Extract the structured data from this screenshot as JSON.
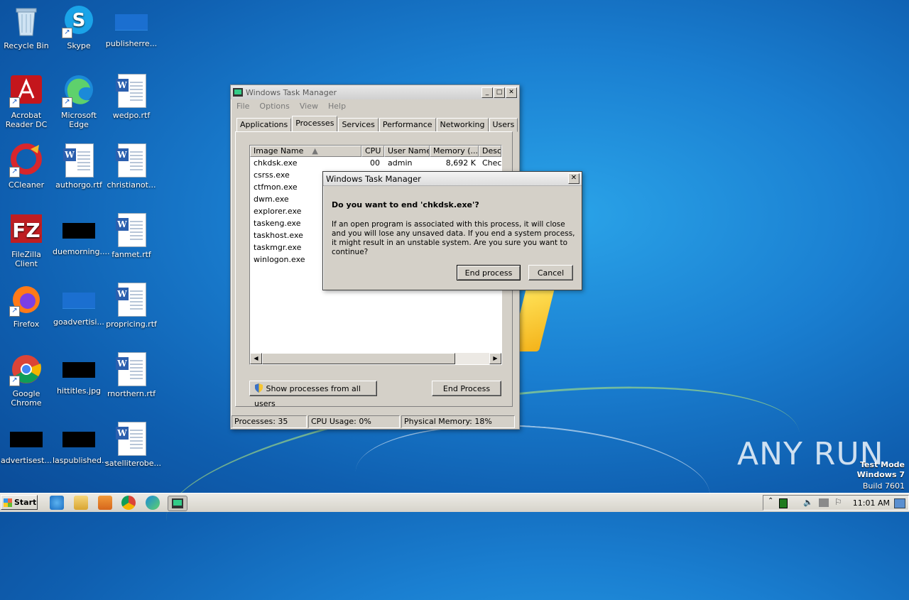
{
  "desktop": {
    "icons": [
      {
        "label": "Recycle Bin"
      },
      {
        "label": "Skype"
      },
      {
        "label": "publisherre..."
      },
      {
        "label": "Acrobat Reader DC"
      },
      {
        "label": "Microsoft Edge"
      },
      {
        "label": "wedpo.rtf"
      },
      {
        "label": "CCleaner"
      },
      {
        "label": "authorgo.rtf"
      },
      {
        "label": "christianot..."
      },
      {
        "label": "FileZilla Client"
      },
      {
        "label": "duemorning...."
      },
      {
        "label": "fanmet.rtf"
      },
      {
        "label": "Firefox"
      },
      {
        "label": "goadvertisi..."
      },
      {
        "label": "propricing.rtf"
      },
      {
        "label": "Google Chrome"
      },
      {
        "label": "hittitles.jpg"
      },
      {
        "label": "rnorthern.rtf"
      },
      {
        "label": "advertisest..."
      },
      {
        "label": "laspublished..."
      },
      {
        "label": "satelliterobe..."
      }
    ],
    "watermark": {
      "brand": "ANY RUN",
      "line1": "Test Mode",
      "line2": "Windows 7",
      "line3": "Build 7601"
    }
  },
  "taskmgr": {
    "title": "Windows Task Manager",
    "menu": [
      "File",
      "Options",
      "View",
      "Help"
    ],
    "tabs": [
      "Applications",
      "Processes",
      "Services",
      "Performance",
      "Networking",
      "Users"
    ],
    "active_tab": "Processes",
    "columns": [
      "Image Name",
      "CPU",
      "User Name",
      "Memory (...",
      "Desc"
    ],
    "rows": [
      [
        "chkdsk.exe",
        "00",
        "admin",
        "8,692 K",
        "Chec"
      ],
      [
        "csrss.exe",
        "",
        "",
        "",
        ""
      ],
      [
        "ctfmon.exe",
        "",
        "",
        "",
        ""
      ],
      [
        "dwm.exe",
        "",
        "",
        "",
        ""
      ],
      [
        "explorer.exe",
        "",
        "",
        "",
        ""
      ],
      [
        "taskeng.exe",
        "",
        "",
        "",
        ""
      ],
      [
        "taskhost.exe",
        "",
        "",
        "",
        ""
      ],
      [
        "taskmgr.exe",
        "",
        "",
        "",
        ""
      ],
      [
        "winlogon.exe",
        "",
        "",
        "",
        ""
      ]
    ],
    "show_all_label": "Show processes from all users",
    "end_process_label": "End Process",
    "status": {
      "processes": "Processes: 35",
      "cpu": "CPU Usage: 0%",
      "memory": "Physical Memory: 18%"
    }
  },
  "dialog": {
    "title": "Windows Task Manager",
    "question": "Do you want to end 'chkdsk.exe'?",
    "message": "If an open program is associated with this process, it will close and you will lose any unsaved data. If you end a system process, it might result in an unstable system. Are you sure you want to continue?",
    "ok_label": "End process",
    "cancel_label": "Cancel"
  },
  "taskbar": {
    "start_label": "Start",
    "clock": "11:01 AM"
  }
}
